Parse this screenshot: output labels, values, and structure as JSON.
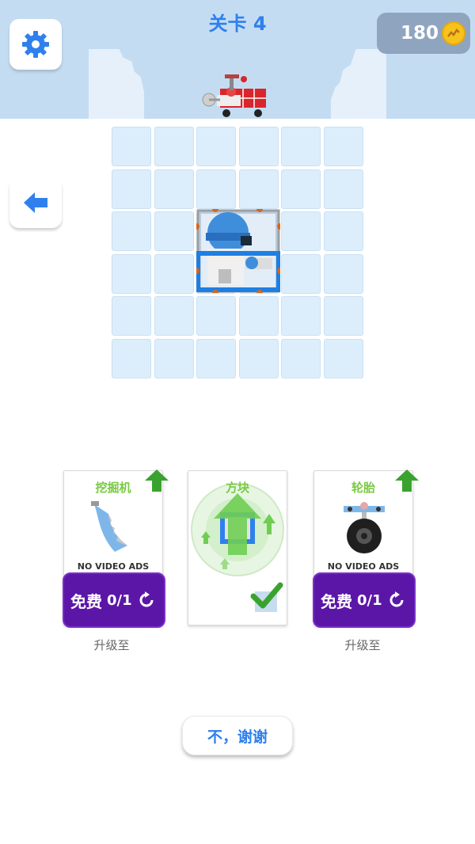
{
  "header": {
    "level_title": "关卡 4",
    "coins": "180"
  },
  "grid": {
    "rows": 6,
    "cols": 6,
    "filled_cells": [
      "row 3-4, col 3-4"
    ]
  },
  "cards": [
    {
      "title": "挖掘机",
      "no_ads": "NO VIDEO ADS",
      "free_label": "免费",
      "free_count": "0/1",
      "upgrade_label": "升级至"
    },
    {
      "title": "方块",
      "selected": true
    },
    {
      "title": "轮胎",
      "no_ads": "NO VIDEO ADS",
      "free_label": "免费",
      "free_count": "0/1",
      "upgrade_label": "升级至"
    }
  ],
  "no_thanks": "不，谢谢",
  "colors": {
    "accent_blue": "#2f80ed",
    "purple_button": "#5c16a7",
    "green_text": "#7ac943",
    "sky": "#c4dcf2",
    "grid_cell": "#dceefb"
  },
  "icons": [
    "gear-icon",
    "back-arrow-icon",
    "coin-icon",
    "upgrade-arrow-icon",
    "refresh-icon",
    "check-icon"
  ]
}
